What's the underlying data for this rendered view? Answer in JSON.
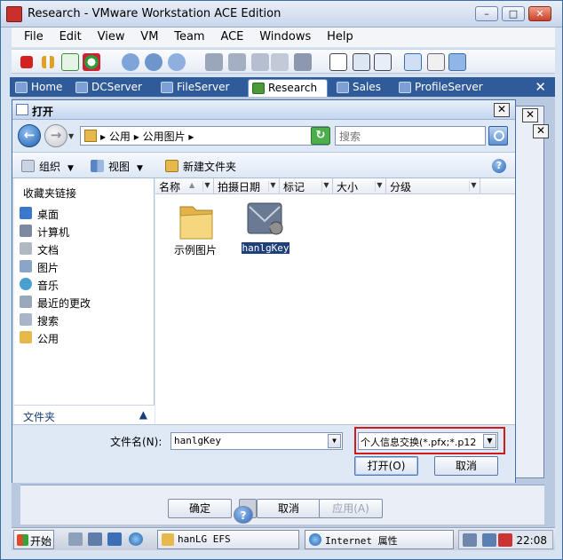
{
  "window": {
    "title": "Research - VMware Workstation ACE Edition",
    "minimize": "–",
    "maximize": "□",
    "close": "✕"
  },
  "menu": [
    "File",
    "Edit",
    "View",
    "VM",
    "Team",
    "ACE",
    "Windows",
    "Help"
  ],
  "vm_tabs": {
    "items": [
      "Home",
      "DCServer",
      "FileServer",
      "Research",
      "Sales",
      "ProfileServer"
    ],
    "active": "Research",
    "close": "✕"
  },
  "dialog": {
    "title": "打开",
    "close": "✕",
    "address": {
      "back": "←",
      "forward": "→",
      "path_1": "公用",
      "path_2": "公用图片",
      "sep": "▸",
      "dropdown": "▼",
      "refresh": "↻"
    },
    "search": {
      "placeholder": "搜索"
    },
    "commands": {
      "organize": "组织",
      "views": "视图",
      "new_folder": "新建文件夹",
      "help": "?"
    },
    "nav": {
      "favorites_title": "收藏夹链接",
      "items": [
        "桌面",
        "计算机",
        "文档",
        "图片",
        "音乐",
        "最近的更改",
        "搜索",
        "公用"
      ],
      "folders_label": "文件夹",
      "folders_chevron": "▲"
    },
    "columns": [
      "名称",
      "拍摄日期",
      "标记",
      "大小",
      "分级"
    ],
    "sort_arrow": "▲",
    "files": [
      {
        "name": "示例图片",
        "type": "folder"
      },
      {
        "name": "hanlgKey",
        "type": "certificate",
        "selected": true
      }
    ],
    "filename_label": "文件名(N):",
    "filename_value": "hanlgKey",
    "filetype_value": "个人信息交换(*.pfx;*.p12",
    "open_button": "打开(O)",
    "cancel_button": "取消"
  },
  "background": {
    "ok_button": "确定",
    "cancel_button": "取消",
    "apply_button": "应用(A)"
  },
  "taskbar": {
    "start": "开始",
    "tasks": [
      "hanLG EFS",
      "Internet 属性"
    ],
    "clock": "22:08"
  },
  "colors": {
    "highlight_border": "#d21a1a",
    "selection": "#1f3f7a",
    "tab_bar": "#2f5b9a"
  }
}
